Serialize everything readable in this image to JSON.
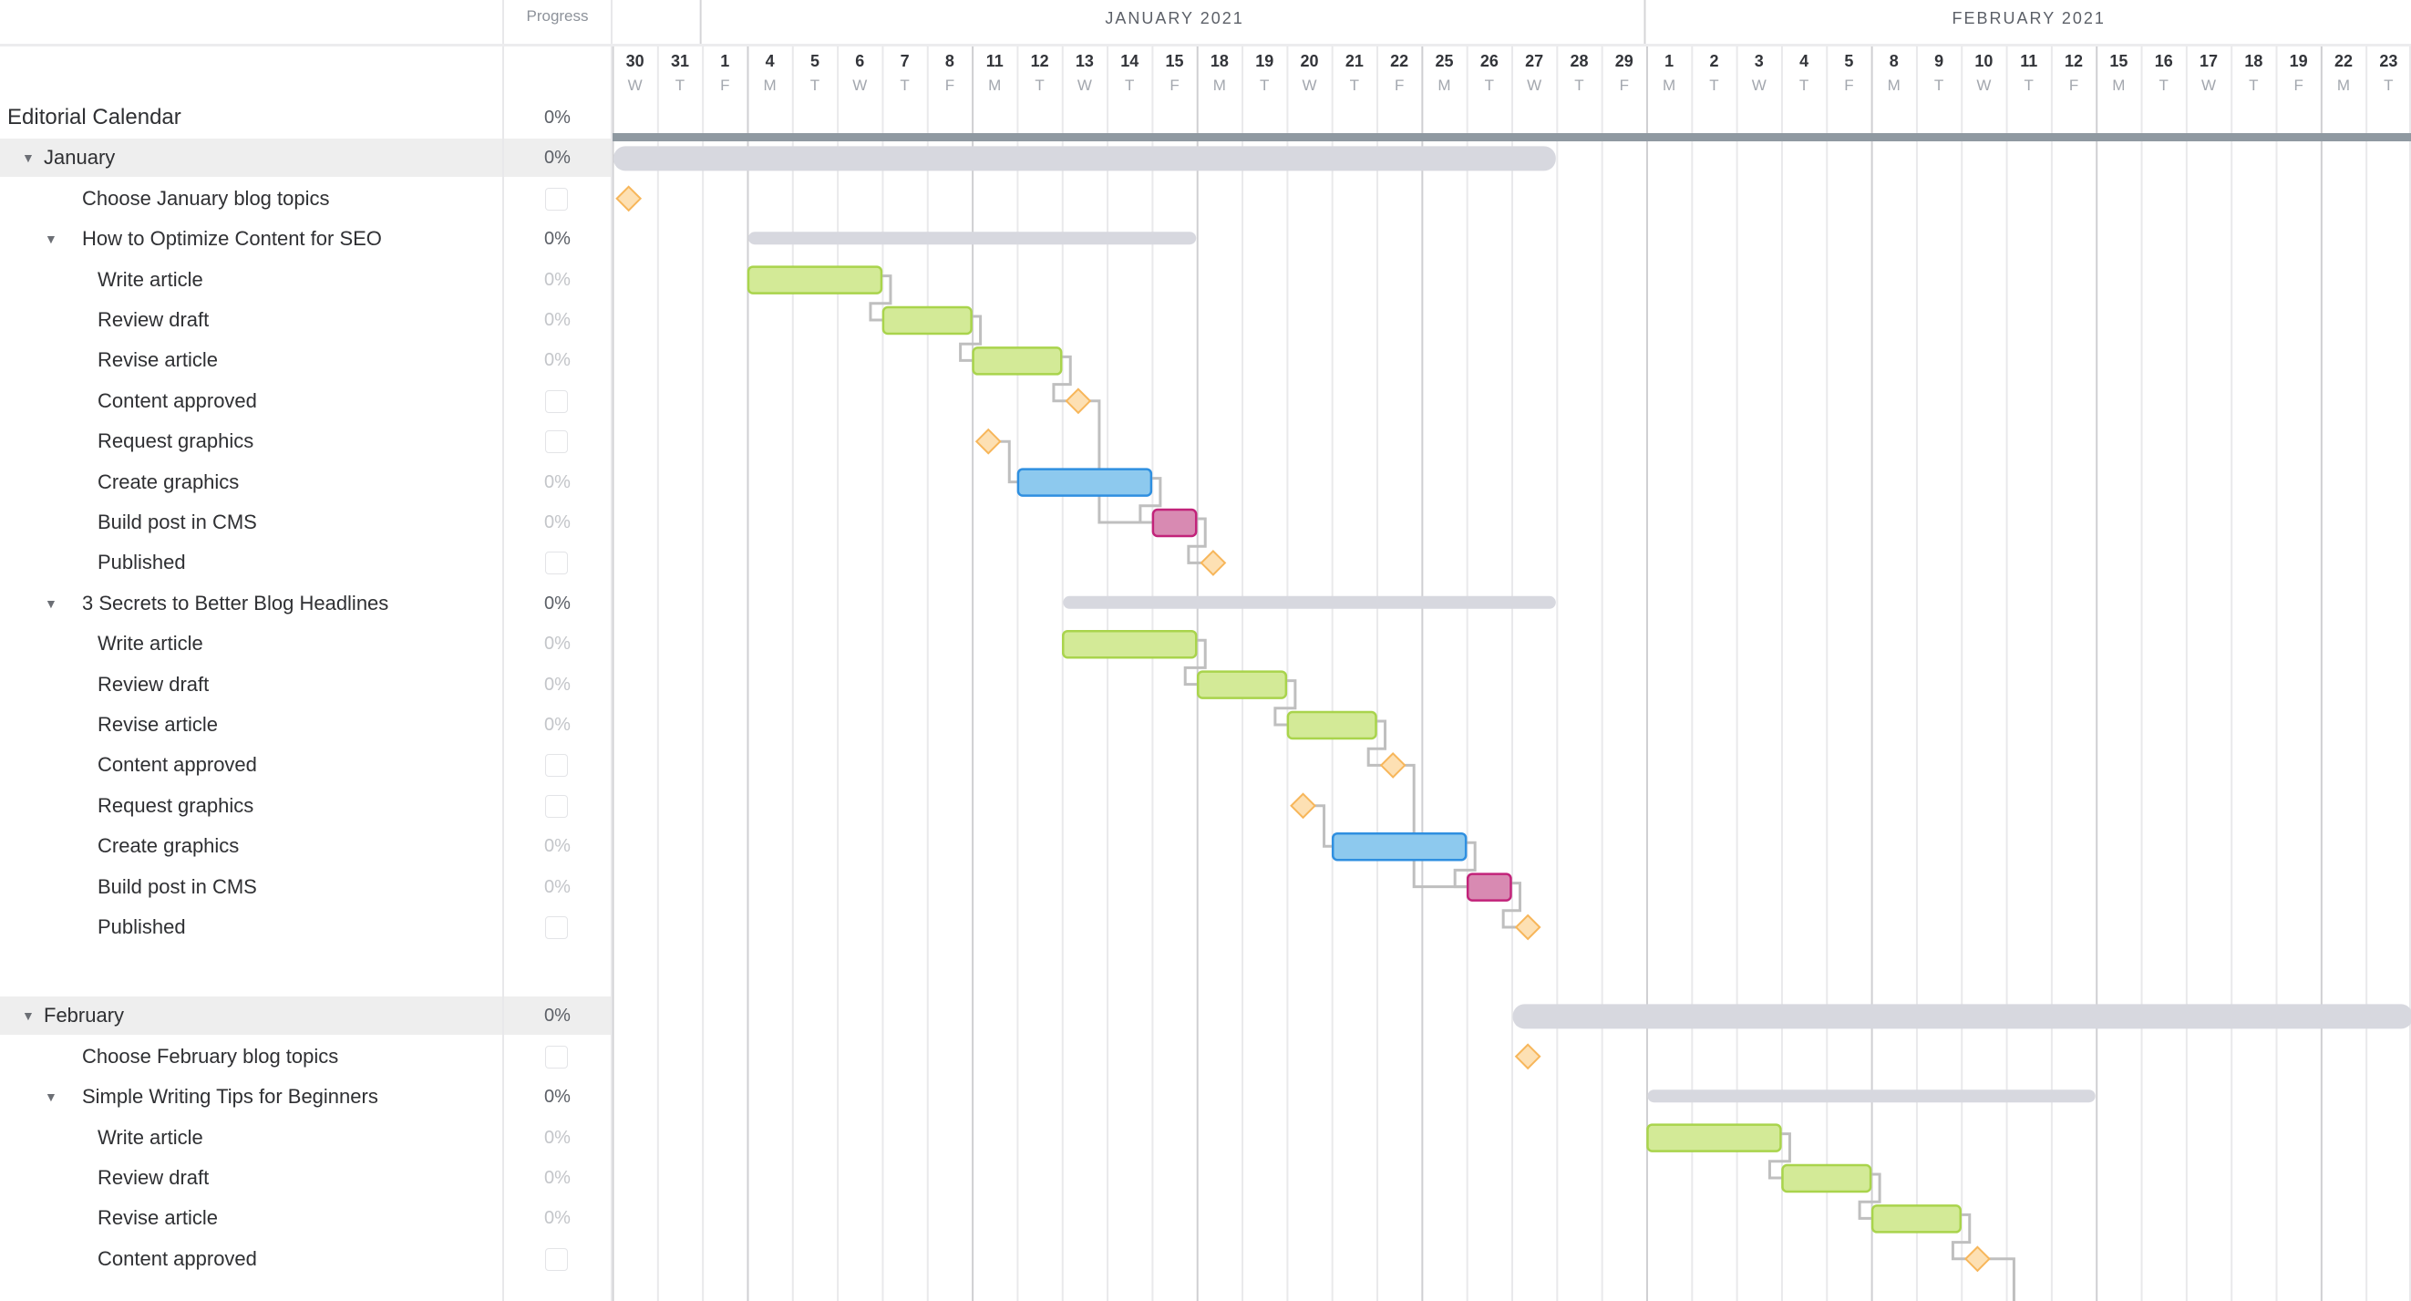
{
  "header": {
    "progress_label": "Progress",
    "months": [
      {
        "label": "JANUARY 2021",
        "first_day_index": 2,
        "last_day_index": 22
      },
      {
        "label": "FEBRUARY 2021",
        "first_day_index": 23,
        "last_day_index": 39
      }
    ],
    "days": [
      {
        "num": "30",
        "dow": "W",
        "date": "2020-12-30"
      },
      {
        "num": "31",
        "dow": "T",
        "date": "2020-12-31"
      },
      {
        "num": "1",
        "dow": "F",
        "date": "2021-01-01"
      },
      {
        "num": "4",
        "dow": "M",
        "date": "2021-01-04"
      },
      {
        "num": "5",
        "dow": "T",
        "date": "2021-01-05"
      },
      {
        "num": "6",
        "dow": "W",
        "date": "2021-01-06"
      },
      {
        "num": "7",
        "dow": "T",
        "date": "2021-01-07"
      },
      {
        "num": "8",
        "dow": "F",
        "date": "2021-01-08"
      },
      {
        "num": "11",
        "dow": "M",
        "date": "2021-01-11"
      },
      {
        "num": "12",
        "dow": "T",
        "date": "2021-01-12"
      },
      {
        "num": "13",
        "dow": "W",
        "date": "2021-01-13"
      },
      {
        "num": "14",
        "dow": "T",
        "date": "2021-01-14"
      },
      {
        "num": "15",
        "dow": "F",
        "date": "2021-01-15"
      },
      {
        "num": "18",
        "dow": "M",
        "date": "2021-01-18"
      },
      {
        "num": "19",
        "dow": "T",
        "date": "2021-01-19"
      },
      {
        "num": "20",
        "dow": "W",
        "date": "2021-01-20"
      },
      {
        "num": "21",
        "dow": "T",
        "date": "2021-01-21"
      },
      {
        "num": "22",
        "dow": "F",
        "date": "2021-01-22"
      },
      {
        "num": "25",
        "dow": "M",
        "date": "2021-01-25"
      },
      {
        "num": "26",
        "dow": "T",
        "date": "2021-01-26"
      },
      {
        "num": "27",
        "dow": "W",
        "date": "2021-01-27"
      },
      {
        "num": "28",
        "dow": "T",
        "date": "2021-01-28"
      },
      {
        "num": "29",
        "dow": "F",
        "date": "2021-01-29"
      },
      {
        "num": "1",
        "dow": "M",
        "date": "2021-02-01"
      },
      {
        "num": "2",
        "dow": "T",
        "date": "2021-02-02"
      },
      {
        "num": "3",
        "dow": "W",
        "date": "2021-02-03"
      },
      {
        "num": "4",
        "dow": "T",
        "date": "2021-02-04"
      },
      {
        "num": "5",
        "dow": "F",
        "date": "2021-02-05"
      },
      {
        "num": "8",
        "dow": "M",
        "date": "2021-02-08"
      },
      {
        "num": "9",
        "dow": "T",
        "date": "2021-02-09"
      },
      {
        "num": "10",
        "dow": "W",
        "date": "2021-02-10"
      },
      {
        "num": "11",
        "dow": "T",
        "date": "2021-02-11"
      },
      {
        "num": "12",
        "dow": "F",
        "date": "2021-02-12"
      },
      {
        "num": "15",
        "dow": "M",
        "date": "2021-02-15"
      },
      {
        "num": "16",
        "dow": "T",
        "date": "2021-02-16"
      },
      {
        "num": "17",
        "dow": "W",
        "date": "2021-02-17"
      },
      {
        "num": "18",
        "dow": "T",
        "date": "2021-02-18"
      },
      {
        "num": "19",
        "dow": "F",
        "date": "2021-02-19"
      },
      {
        "num": "22",
        "dow": "M",
        "date": "2021-02-22"
      },
      {
        "num": "23",
        "dow": "T",
        "date": "2021-02-23"
      }
    ]
  },
  "colors": {
    "project_bar": "#8f99a1",
    "group_bar": "#d7d8df",
    "task_green_fill": "#d3ea97",
    "task_green_border": "#a9d44c",
    "task_blue_fill": "#8dc9ee",
    "task_blue_border": "#2f8fe0",
    "task_pink_fill": "#d88ab2",
    "task_pink_border": "#c2237a",
    "milestone_fill": "#fde0b3",
    "milestone_border": "#f7b65a",
    "connector": "#bfbfbf",
    "group_band": "#eeeeee"
  },
  "rows": [
    {
      "id": "editorial",
      "name": "Editorial Calendar",
      "level": 0,
      "kind": "root",
      "progress": "0%",
      "bar": {
        "type": "project",
        "start": "2020-12-30",
        "end": "2021-02-23",
        "continues": true
      }
    },
    {
      "id": "jan",
      "name": "January",
      "level": 1,
      "kind": "group",
      "progress": "0%",
      "collapsible": true,
      "band": true,
      "bar": {
        "type": "group",
        "start": "2020-12-30",
        "end": "2021-01-27"
      }
    },
    {
      "id": "jan-topics",
      "name": "Choose January blog topics",
      "level": 2,
      "kind": "milestone",
      "checkbox": true,
      "bar": {
        "type": "milestone",
        "date": "2020-12-30"
      }
    },
    {
      "id": "seo",
      "name": "How to Optimize Content for SEO",
      "level": 2,
      "kind": "subgroup",
      "progress": "0%",
      "collapsible": true,
      "bar": {
        "type": "subgroup",
        "start": "2021-01-04",
        "end": "2021-01-15"
      }
    },
    {
      "id": "seo-write",
      "name": "Write article",
      "level": 3,
      "kind": "task",
      "progress": "0%",
      "bar": {
        "type": "task",
        "color": "green",
        "start": "2021-01-04",
        "end": "2021-01-06"
      }
    },
    {
      "id": "seo-review",
      "name": "Review draft",
      "level": 3,
      "kind": "task",
      "progress": "0%",
      "bar": {
        "type": "task",
        "color": "green",
        "start": "2021-01-07",
        "end": "2021-01-08"
      }
    },
    {
      "id": "seo-revise",
      "name": "Revise article",
      "level": 3,
      "kind": "task",
      "progress": "0%",
      "bar": {
        "type": "task",
        "color": "green",
        "start": "2021-01-11",
        "end": "2021-01-12"
      }
    },
    {
      "id": "seo-approved",
      "name": "Content approved",
      "level": 3,
      "kind": "milestone",
      "checkbox": true,
      "bar": {
        "type": "milestone",
        "date": "2021-01-13"
      }
    },
    {
      "id": "seo-request",
      "name": "Request graphics",
      "level": 3,
      "kind": "milestone",
      "checkbox": true,
      "bar": {
        "type": "milestone",
        "date": "2021-01-11"
      }
    },
    {
      "id": "seo-create",
      "name": "Create graphics",
      "level": 3,
      "kind": "task",
      "progress": "0%",
      "bar": {
        "type": "task",
        "color": "blue",
        "start": "2021-01-12",
        "end": "2021-01-14"
      }
    },
    {
      "id": "seo-build",
      "name": "Build post in CMS",
      "level": 3,
      "kind": "task",
      "progress": "0%",
      "bar": {
        "type": "task",
        "color": "pink",
        "start": "2021-01-15",
        "end": "2021-01-15"
      }
    },
    {
      "id": "seo-published",
      "name": "Published",
      "level": 3,
      "kind": "milestone",
      "checkbox": true,
      "bar": {
        "type": "milestone",
        "date": "2021-01-18"
      }
    },
    {
      "id": "hl",
      "name": "3 Secrets to Better Blog Headlines",
      "level": 2,
      "kind": "subgroup",
      "progress": "0%",
      "collapsible": true,
      "bar": {
        "type": "subgroup",
        "start": "2021-01-13",
        "end": "2021-01-27"
      }
    },
    {
      "id": "hl-write",
      "name": "Write article",
      "level": 3,
      "kind": "task",
      "progress": "0%",
      "bar": {
        "type": "task",
        "color": "green",
        "start": "2021-01-13",
        "end": "2021-01-15"
      }
    },
    {
      "id": "hl-review",
      "name": "Review draft",
      "level": 3,
      "kind": "task",
      "progress": "0%",
      "bar": {
        "type": "task",
        "color": "green",
        "start": "2021-01-18",
        "end": "2021-01-19"
      }
    },
    {
      "id": "hl-revise",
      "name": "Revise article",
      "level": 3,
      "kind": "task",
      "progress": "0%",
      "bar": {
        "type": "task",
        "color": "green",
        "start": "2021-01-20",
        "end": "2021-01-21"
      }
    },
    {
      "id": "hl-approved",
      "name": "Content approved",
      "level": 3,
      "kind": "milestone",
      "checkbox": true,
      "bar": {
        "type": "milestone",
        "date": "2021-01-22"
      }
    },
    {
      "id": "hl-request",
      "name": "Request graphics",
      "level": 3,
      "kind": "milestone",
      "checkbox": true,
      "bar": {
        "type": "milestone",
        "date": "2021-01-20"
      }
    },
    {
      "id": "hl-create",
      "name": "Create graphics",
      "level": 3,
      "kind": "task",
      "progress": "0%",
      "bar": {
        "type": "task",
        "color": "blue",
        "start": "2021-01-21",
        "end": "2021-01-25"
      }
    },
    {
      "id": "hl-build",
      "name": "Build post in CMS",
      "level": 3,
      "kind": "task",
      "progress": "0%",
      "bar": {
        "type": "task",
        "color": "pink",
        "start": "2021-01-26",
        "end": "2021-01-26"
      }
    },
    {
      "id": "hl-published",
      "name": "Published",
      "level": 3,
      "kind": "milestone",
      "checkbox": true,
      "bar": {
        "type": "milestone",
        "date": "2021-01-27"
      }
    },
    {
      "id": "spacer",
      "kind": "spacer"
    },
    {
      "id": "feb",
      "name": "February",
      "level": 1,
      "kind": "group",
      "progress": "0%",
      "collapsible": true,
      "band": true,
      "bar": {
        "type": "group",
        "start": "2021-01-27",
        "end": "2021-02-23",
        "continues": true
      }
    },
    {
      "id": "feb-topics",
      "name": "Choose February blog topics",
      "level": 2,
      "kind": "milestone",
      "checkbox": true,
      "bar": {
        "type": "milestone",
        "date": "2021-01-27"
      }
    },
    {
      "id": "tips",
      "name": "Simple Writing Tips for Beginners",
      "level": 2,
      "kind": "subgroup",
      "progress": "0%",
      "collapsible": true,
      "bar": {
        "type": "subgroup",
        "start": "2021-02-01",
        "end": "2021-02-12"
      }
    },
    {
      "id": "tips-write",
      "name": "Write article",
      "level": 3,
      "kind": "task",
      "progress": "0%",
      "bar": {
        "type": "task",
        "color": "green",
        "start": "2021-02-01",
        "end": "2021-02-03"
      }
    },
    {
      "id": "tips-review",
      "name": "Review draft",
      "level": 3,
      "kind": "task",
      "progress": "0%",
      "bar": {
        "type": "task",
        "color": "green",
        "start": "2021-02-04",
        "end": "2021-02-05"
      }
    },
    {
      "id": "tips-revise",
      "name": "Revise article",
      "level": 3,
      "kind": "task",
      "progress": "0%",
      "bar": {
        "type": "task",
        "color": "green",
        "start": "2021-02-08",
        "end": "2021-02-09"
      }
    },
    {
      "id": "tips-approved",
      "name": "Content approved",
      "level": 3,
      "kind": "milestone",
      "checkbox": true,
      "bar": {
        "type": "milestone",
        "date": "2021-02-10"
      }
    }
  ],
  "dependencies": [
    [
      "seo-write",
      "seo-review"
    ],
    [
      "seo-review",
      "seo-revise"
    ],
    [
      "seo-revise",
      "seo-approved"
    ],
    [
      "seo-approved",
      "seo-build"
    ],
    [
      "seo-request",
      "seo-create"
    ],
    [
      "seo-create",
      "seo-build"
    ],
    [
      "seo-build",
      "seo-published"
    ],
    [
      "hl-write",
      "hl-review"
    ],
    [
      "hl-review",
      "hl-revise"
    ],
    [
      "hl-revise",
      "hl-approved"
    ],
    [
      "hl-approved",
      "hl-build"
    ],
    [
      "hl-request",
      "hl-create"
    ],
    [
      "hl-create",
      "hl-build"
    ],
    [
      "hl-build",
      "hl-published"
    ],
    [
      "tips-write",
      "tips-review"
    ],
    [
      "tips-review",
      "tips-revise"
    ],
    [
      "tips-revise",
      "tips-approved"
    ],
    [
      "tips-approved",
      "tips-next"
    ]
  ]
}
